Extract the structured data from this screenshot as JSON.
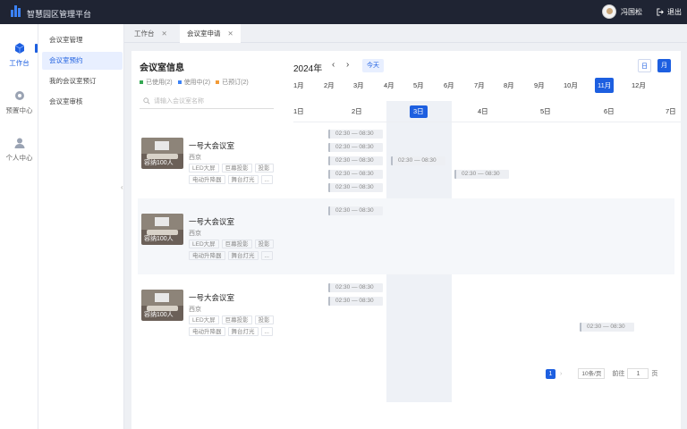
{
  "app": {
    "title": "智慧园区管理平台",
    "user": "冯国松",
    "logout": "退出"
  },
  "sidebar": {
    "items": [
      {
        "label": "工作台"
      },
      {
        "label": "预置中心"
      },
      {
        "label": "个人中心"
      }
    ]
  },
  "submenu": {
    "items": [
      {
        "label": "会议室管理"
      },
      {
        "label": "会议室预约"
      },
      {
        "label": "我的会议室预订"
      },
      {
        "label": "会议室审核"
      }
    ]
  },
  "tabs": [
    {
      "label": "工作台"
    },
    {
      "label": "会议室申请"
    }
  ],
  "panel": {
    "title": "会议室信息",
    "legend": [
      {
        "label": "已使用(2)",
        "color": "#35a853"
      },
      {
        "label": "使用中(2)",
        "color": "#3b82f6"
      },
      {
        "label": "已预订(2)",
        "color": "#f29b38"
      }
    ],
    "search_placeholder": "请输入会议室名称",
    "year": "2024年",
    "today": "今天",
    "view_day": "日",
    "view_month": "月",
    "months": [
      "1月",
      "2月",
      "3月",
      "4月",
      "5月",
      "6月",
      "7月",
      "8月",
      "9月",
      "10月",
      "11月",
      "12月"
    ],
    "days": [
      "1日",
      "2日",
      "3日",
      "4日",
      "5日",
      "6日",
      "7日"
    ]
  },
  "rooms": [
    {
      "name": "一号大会议室",
      "location": "西京",
      "capacity": "容纳100人",
      "tags": [
        "LED大屏",
        "巨幕投影",
        "投影",
        "电动升降器",
        "舞台灯光",
        "..."
      ]
    },
    {
      "name": "一号大会议室",
      "location": "西京",
      "capacity": "容纳100人",
      "tags": [
        "LED大屏",
        "巨幕投影",
        "投影",
        "电动升降器",
        "舞台灯光",
        "..."
      ]
    },
    {
      "name": "一号大会议室",
      "location": "西京",
      "capacity": "容纳100人",
      "tags": [
        "LED大屏",
        "巨幕投影",
        "投影",
        "电动升降器",
        "舞台灯光",
        "..."
      ]
    }
  ],
  "slots": {
    "time": "02:30 — 08:30"
  },
  "pagination": {
    "page": "1",
    "page_size": "10条/页",
    "goto": "前往",
    "goto_value": "1",
    "page_unit": "页"
  },
  "icons": {
    "logo": "bar-chart-logo-icon",
    "workbench": "cube-icon",
    "preset": "gear-icon",
    "personal": "user-icon",
    "logout": "logout-icon",
    "search": "search-icon"
  }
}
